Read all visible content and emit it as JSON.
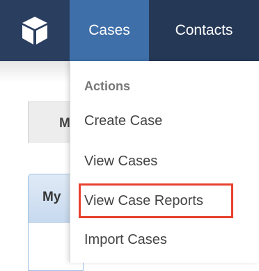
{
  "navbar": {
    "logo_icon": "cube-icon",
    "tabs": [
      {
        "label": "Cases",
        "active": true
      },
      {
        "label": "Contacts",
        "active": false
      }
    ],
    "colors": {
      "bar": "#253856",
      "active_tab": "#3f6fa8"
    }
  },
  "background": {
    "tab_label": "M",
    "panel_label": "My"
  },
  "menu": {
    "header": "Actions",
    "items": [
      {
        "label": "Create Case"
      },
      {
        "label": "View Cases"
      },
      {
        "label": "View Case Reports",
        "highlighted": true
      },
      {
        "label": "Import Cases"
      }
    ],
    "highlight_color": "#e8402f"
  }
}
